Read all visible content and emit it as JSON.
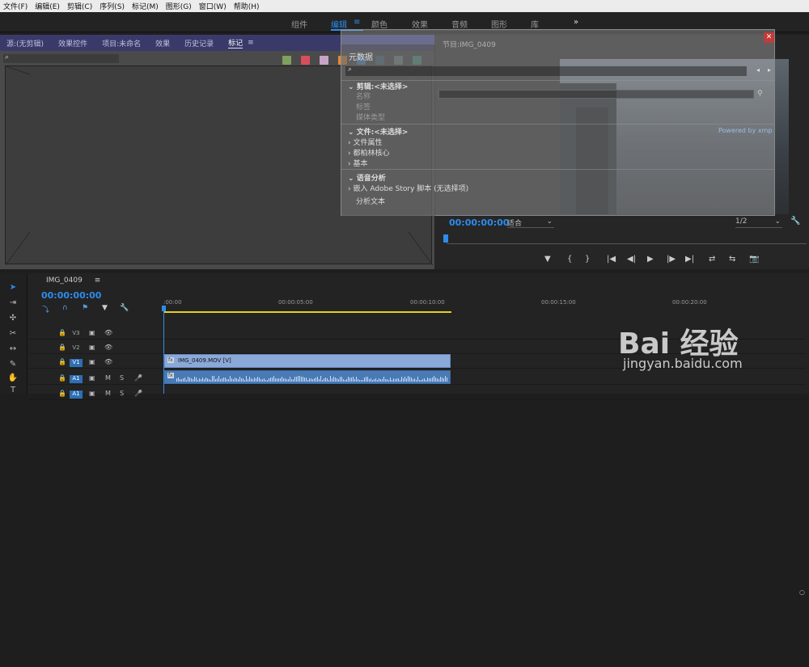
{
  "menubar": {
    "items": [
      "文件(F)",
      "编辑(E)",
      "剪辑(C)",
      "序列(S)",
      "标记(M)",
      "图形(G)",
      "窗口(W)",
      "帮助(H)"
    ]
  },
  "workspaces": {
    "tabs": [
      "组件",
      "编辑",
      "颜色",
      "效果",
      "音频",
      "图形",
      "库"
    ],
    "active": "编辑",
    "more": "»"
  },
  "source_panel": {
    "tabs": [
      "源:(无剪辑)",
      "效果控件",
      "项目:未命名",
      "效果",
      "历史记录",
      "标记"
    ],
    "active_tab": "标记",
    "menu_icon": "≡",
    "swatch_colors": [
      "#7fa05e",
      "#d84f5b",
      "#c9a3c7",
      "#e18a3a",
      "#4f8fcf",
      "#4a6a86",
      "#7a8b8b",
      "#4d9c8e"
    ]
  },
  "program_panel": {
    "title": "节目:IMG_0409",
    "timecode": "00:00:00:00",
    "fit": "适合",
    "resolution": "1/2",
    "controls": [
      "▼",
      "{",
      "}",
      "|◀",
      "◀|",
      "▶",
      "|▶",
      "▶|",
      "⇄",
      "⇆",
      "📷"
    ]
  },
  "metadata_panel": {
    "title": "元数据",
    "rows": [
      {
        "text": "剪辑:<未选择>",
        "kind": "section"
      },
      {
        "text": "名称",
        "kind": "sub"
      },
      {
        "text": "标签",
        "kind": "sub"
      },
      {
        "text": "媒体类型",
        "kind": "sub"
      },
      {
        "text": "文件:<未选择>",
        "kind": "section"
      },
      {
        "text": "文件属性",
        "kind": "item"
      },
      {
        "text": "都柏林核心",
        "kind": "item"
      },
      {
        "text": "基本",
        "kind": "item"
      },
      {
        "text": "语音分析",
        "kind": "section"
      },
      {
        "text": "嵌入 Adobe Story 脚本 (无选择项)",
        "kind": "item"
      },
      {
        "text": "分析文本",
        "kind": "plain"
      }
    ],
    "powered_by": "Powered by xmp"
  },
  "timeline": {
    "title": "IMG_0409",
    "menu_icon": "≡",
    "timecode": "00:00:00:00",
    "ruler_labels": [
      ":00:00",
      "00:00:05:00",
      "00:00:10:00",
      "00:00:15:00",
      "00:00:20:00"
    ],
    "tracks": [
      {
        "label": "V3",
        "active": false
      },
      {
        "label": "V2",
        "active": false
      },
      {
        "label": "V1",
        "active": true
      },
      {
        "label": "A1",
        "active": true
      },
      {
        "label": "A1",
        "active": true
      }
    ],
    "clip_v1": "IMG_0409.MOV [V]",
    "fx_badge": "fx"
  },
  "watermark": {
    "brand": "Bai 经验",
    "url": "jingyan.baidu.com"
  }
}
